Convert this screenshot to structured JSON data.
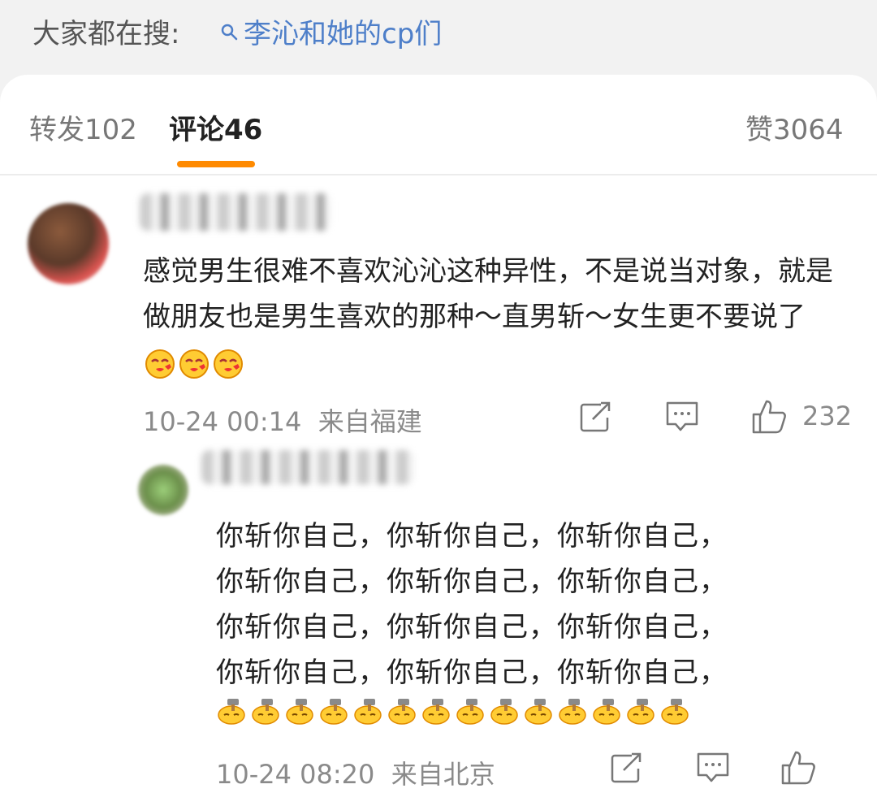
{
  "search": {
    "prefix": "大家都在搜:",
    "query": "李沁和她的cp们"
  },
  "tabs": {
    "repost": "转发102",
    "comments": "评论46",
    "likes": "赞3064"
  },
  "comment": {
    "text": "感觉男生很难不喜欢沁沁这种异性，不是说当对象，就是做朋友也是男生喜欢的那种～直男斩～女生更不要说了",
    "emoji_count": 3,
    "time": "10-24 00:14",
    "location": "来自福建",
    "like_count": "232"
  },
  "reply": {
    "lines": [
      "你斩你自己，你斩你自己，你斩你自己，",
      "你斩你自己，你斩你自己，你斩你自己，",
      "你斩你自己，你斩你自己，你斩你自己，",
      "你斩你自己，你斩你自己，你斩你自己，"
    ],
    "hammer_emoji_count": 14,
    "time": "10-24 08:20",
    "location": "来自北京"
  },
  "colors": {
    "link": "#4e7fc9",
    "tab_accent": "#ff8a00",
    "meta_text": "#8a8a8a"
  },
  "icons": [
    "search-icon",
    "share-icon",
    "reply-icon",
    "like-icon",
    "kiss-emoji",
    "hammer-emoji"
  ]
}
